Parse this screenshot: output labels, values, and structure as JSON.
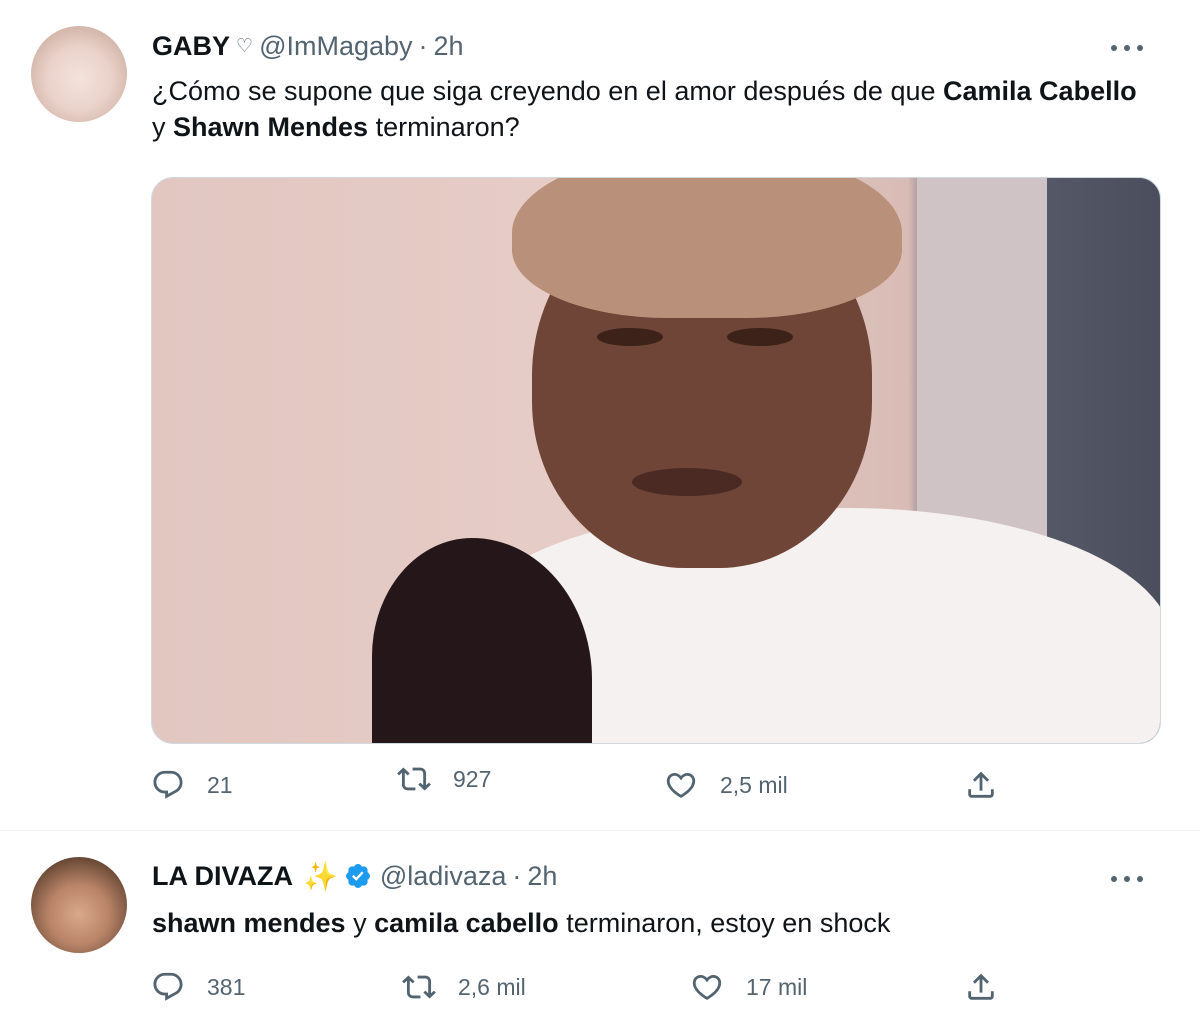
{
  "tweets": [
    {
      "name": "GABY",
      "name_symbol": "♡",
      "handle": "@ImMagaby",
      "separator": "·",
      "time": "2h",
      "text_parts": [
        "¿Cómo se supone que siga creyendo en el amor después de que ",
        "Camila Cabello",
        " y ",
        "Shawn Mendes",
        " terminaron?"
      ],
      "replies": "21",
      "retweets": "927",
      "likes": "2,5 mil"
    },
    {
      "name": "LA DIVAZA",
      "name_symbol": "✨",
      "handle": "@ladivaza",
      "separator": "·",
      "time": "2h",
      "text_parts": [
        "shawn mendes",
        " y ",
        "camila cabello",
        " terminaron, estoy en shock"
      ],
      "replies": "381",
      "retweets": "2,6 mil",
      "likes": "17 mil"
    }
  ],
  "icons": {
    "reply": "reply-icon",
    "retweet": "retweet-icon",
    "like": "like-icon",
    "share": "share-icon",
    "more": "more-icon",
    "verified": "verified-badge-icon"
  },
  "colors": {
    "text": "#0f1419",
    "secondary": "#536471",
    "verified": "#1d9bf0",
    "divider": "#eff3f4"
  }
}
